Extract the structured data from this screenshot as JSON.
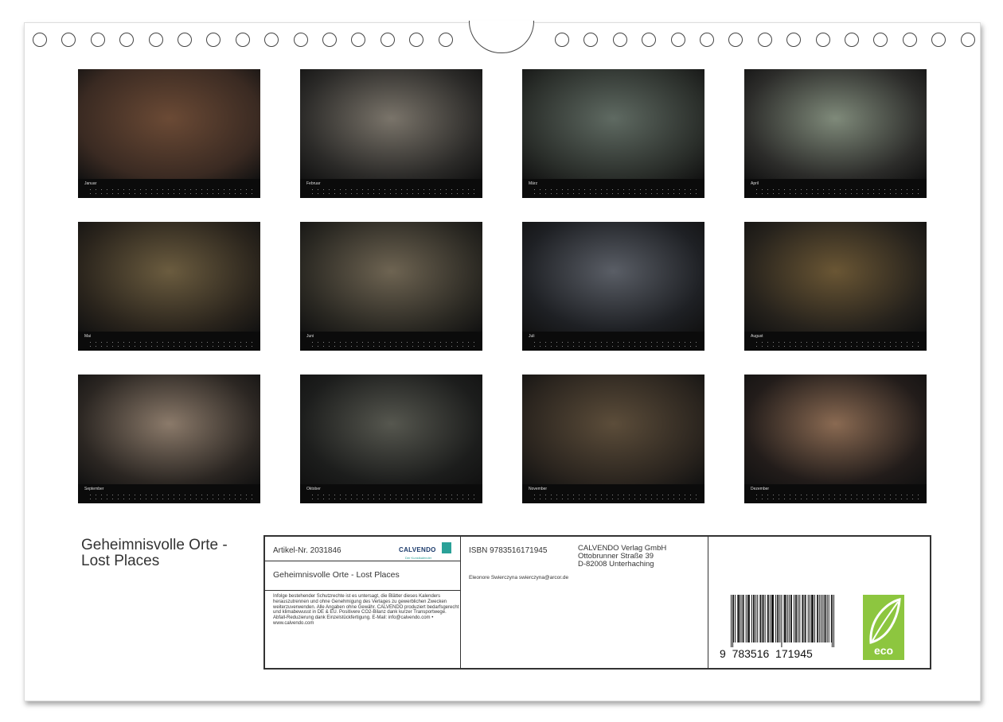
{
  "months": [
    "Januar",
    "Februar",
    "März",
    "April",
    "Mai",
    "Juni",
    "Juli",
    "August",
    "September",
    "Oktober",
    "November",
    "Dezember"
  ],
  "title": "Geheimnisvolle Orte -\nLost Places",
  "info": {
    "artikel": "Artikel-Nr. 2031846",
    "brand": "CALVENDO",
    "brand_sub": "Der Kunstkalender",
    "book_title": "Geheimnisvolle Orte - Lost Places",
    "legal": "Infolge bestehender Schutzrechte ist es untersagt, die Blätter dieses Kalenders herauszutrennen und ohne Genehmigung des Verlages zu gewerblichen Zwecken weiterzuverwenden. Alle Angaben ohne Gewähr. CALVENDO produziert bedarfsgerecht und klimabewusst in DE & EU. Positivere CO2-Bilanz dank kurzer Transportwege. Abfall-Reduzierung dank Einzelstückfertigung. E-Mail: info@calvendo.com • www.calvendo.com",
    "isbn": "ISBN 9783516171945",
    "publisher": [
      "CALVENDO Verlag GmbH",
      "Ottobrunner Straße 39",
      "D-82008 Unterhaching"
    ],
    "author": "Eleonore Swierczyna swierczyna@arcor.de",
    "barcode_text": "9  783516  171945",
    "eco_label": "eco"
  },
  "colors": {
    "eco": "#8dc63f",
    "brand_blue": "#1b3a6b",
    "brand_green": "#2aa198"
  }
}
